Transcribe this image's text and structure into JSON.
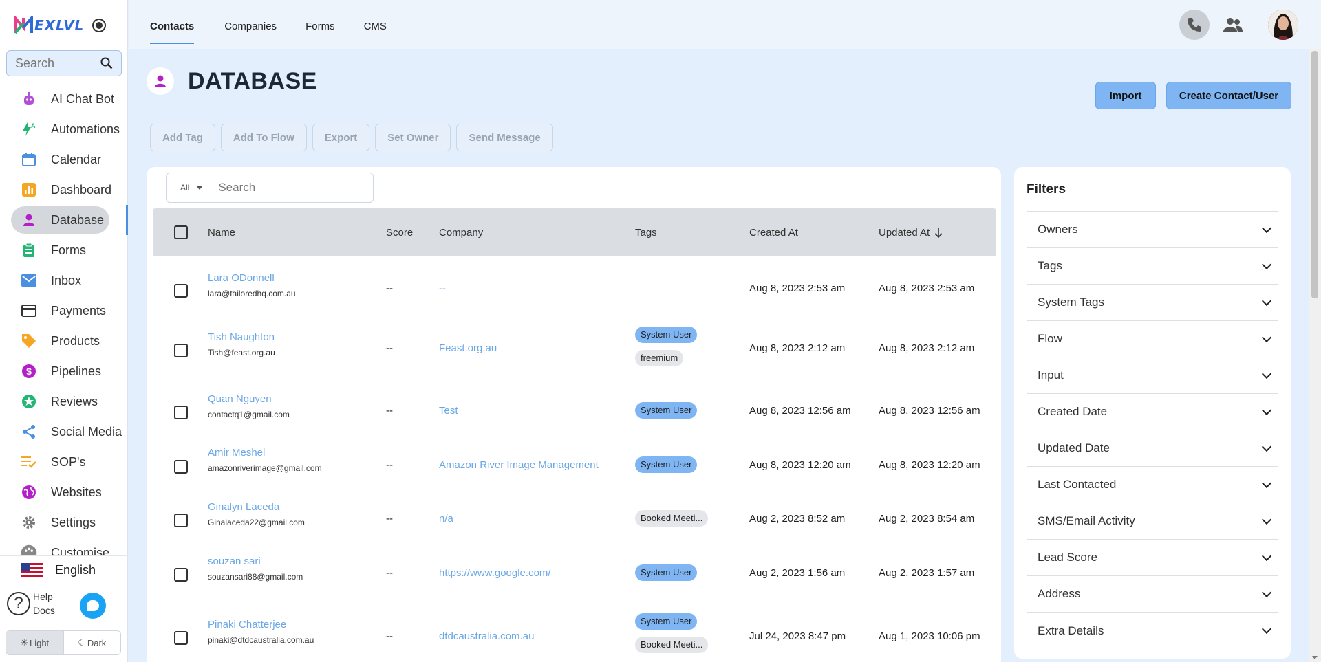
{
  "app": {
    "brand": "EXLVL"
  },
  "sidebar": {
    "search_placeholder": "Search",
    "items": [
      {
        "label": "AI Chat Bot",
        "icon": "robot-icon",
        "color": "#b34fd6"
      },
      {
        "label": "Automations",
        "icon": "lightning-icon",
        "color": "#22b573"
      },
      {
        "label": "Calendar",
        "icon": "calendar-icon",
        "color": "#4a8fe0"
      },
      {
        "label": "Dashboard",
        "icon": "bar-chart-icon",
        "color": "#f5a623"
      },
      {
        "label": "Database",
        "icon": "person-icon",
        "color": "#b320c8"
      },
      {
        "label": "Forms",
        "icon": "clipboard-icon",
        "color": "#22b573"
      },
      {
        "label": "Inbox",
        "icon": "mail-icon",
        "color": "#4a8fe0"
      },
      {
        "label": "Payments",
        "icon": "card-icon",
        "color": "#333333"
      },
      {
        "label": "Products",
        "icon": "tag-icon",
        "color": "#f5a623"
      },
      {
        "label": "Pipelines",
        "icon": "dollar-icon",
        "color": "#b320c8"
      },
      {
        "label": "Reviews",
        "icon": "star-icon",
        "color": "#22b573"
      },
      {
        "label": "Social Media",
        "icon": "share-icon",
        "color": "#4a8fe0"
      },
      {
        "label": "SOP's",
        "icon": "checklist-icon",
        "color": "#f5a623"
      },
      {
        "label": "Websites",
        "icon": "globe-icon",
        "color": "#b320c8"
      },
      {
        "label": "Settings",
        "icon": "gear-icon",
        "color": "#777777"
      },
      {
        "label": "Customise",
        "icon": "palette-icon",
        "color": "#888888"
      }
    ],
    "active": "Database",
    "language": "English",
    "help": [
      "Help",
      "Docs"
    ],
    "theme": {
      "light": "Light",
      "dark": "Dark"
    }
  },
  "topbar": {
    "tabs": [
      "Contacts",
      "Companies",
      "Forms",
      "CMS"
    ],
    "active_tab": "Contacts"
  },
  "page": {
    "title": "DATABASE",
    "import_label": "Import",
    "create_label": "Create Contact/User",
    "bulk_actions": [
      "Add Tag",
      "Add To Flow",
      "Export",
      "Set Owner",
      "Send Message"
    ]
  },
  "table": {
    "filter_all": "All",
    "search_placeholder": "Search",
    "headers": {
      "name": "Name",
      "score": "Score",
      "company": "Company",
      "tags": "Tags",
      "created": "Created At",
      "updated": "Updated At"
    },
    "rows": [
      {
        "name": "Lara ODonnell",
        "email": "lara@tailoredhq.com.au",
        "score": "--",
        "company": "--",
        "tags": [],
        "created": "Aug 8, 2023 2:53 am",
        "updated": "Aug 8, 2023 2:53 am"
      },
      {
        "name": "Tish Naughton",
        "email": "Tish@feast.org.au",
        "score": "--",
        "company": "Feast.org.au",
        "tags": [
          {
            "label": "System User",
            "style": "blue"
          },
          {
            "label": "freemium",
            "style": "grey"
          }
        ],
        "created": "Aug 8, 2023 2:12 am",
        "updated": "Aug 8, 2023 2:12 am"
      },
      {
        "name": "Quan Nguyen",
        "email": "contactq1@gmail.com",
        "score": "--",
        "company": "Test",
        "tags": [
          {
            "label": "System User",
            "style": "blue"
          }
        ],
        "created": "Aug 8, 2023 12:56 am",
        "updated": "Aug 8, 2023 12:56 am"
      },
      {
        "name": "Amir Meshel",
        "email": "amazonriverimage@gmail.com",
        "score": "--",
        "company": "Amazon River Image Management",
        "tags": [
          {
            "label": "System User",
            "style": "blue"
          }
        ],
        "created": "Aug 8, 2023 12:20 am",
        "updated": "Aug 8, 2023 12:20 am"
      },
      {
        "name": "Ginalyn Laceda",
        "email": "Ginalaceda22@gmail.com",
        "score": "--",
        "company": "n/a",
        "tags": [
          {
            "label": "Booked Meeti...",
            "style": "grey"
          }
        ],
        "created": "Aug 2, 2023 8:52 am",
        "updated": "Aug 2, 2023 8:54 am"
      },
      {
        "name": "souzan sari",
        "email": "souzansari88@gmail.com",
        "score": "--",
        "company": "https://www.google.com/",
        "tags": [
          {
            "label": "System User",
            "style": "blue"
          }
        ],
        "created": "Aug 2, 2023 1:56 am",
        "updated": "Aug 2, 2023 1:57 am"
      },
      {
        "name": "Pinaki Chatterjee",
        "email": "pinaki@dtdcaustralia.com.au",
        "score": "--",
        "company": "dtdcaustralia.com.au",
        "tags": [
          {
            "label": "System User",
            "style": "blue"
          },
          {
            "label": "Booked Meeti...",
            "style": "grey"
          }
        ],
        "created": "Jul 24, 2023 8:47 pm",
        "updated": "Aug 1, 2023 10:06 pm"
      }
    ]
  },
  "filters": {
    "title": "Filters",
    "items": [
      "Owners",
      "Tags",
      "System Tags",
      "Flow",
      "Input",
      "Created Date",
      "Updated Date",
      "Last Contacted",
      "SMS/Email Activity",
      "Lead Score",
      "Address",
      "Extra Details"
    ]
  }
}
